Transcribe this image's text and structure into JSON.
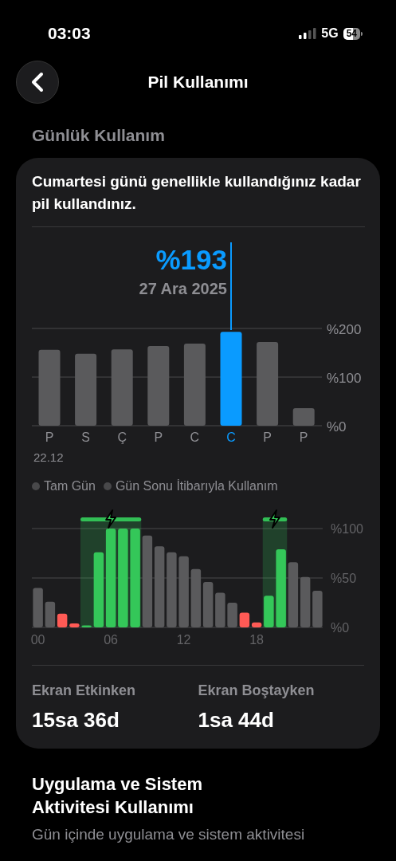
{
  "status_bar": {
    "time": "03:03",
    "network": "5G",
    "battery": "54"
  },
  "nav": {
    "title": "Pil Kullanımı"
  },
  "section_title": "Günlük Kullanım",
  "card": {
    "summary": "Cumartesi günü genellikle kullandığınız kadar pil kullandınız.",
    "weekly": {
      "selected_value": "%193",
      "selected_date": "27 Ara 2025",
      "first_date": "22.12",
      "chart_data": {
        "type": "bar",
        "categories": [
          "P",
          "S",
          "Ç",
          "P",
          "C",
          "C",
          "P",
          "P"
        ],
        "series": [
          {
            "color": "#5a5a5c",
            "values": [
              156,
              148,
              157,
              164,
              169,
              null,
              172,
              36
            ]
          },
          {
            "color": "#0a9bff",
            "values": [
              null,
              null,
              null,
              null,
              null,
              193,
              null,
              null
            ]
          }
        ],
        "ylim": [
          0,
          200
        ],
        "yticks": [
          {
            "value": 0,
            "label": "%0"
          },
          {
            "value": 100,
            "label": "%100"
          },
          {
            "value": 200,
            "label": "%200"
          }
        ]
      }
    },
    "legend": [
      {
        "label": "Tam Gün"
      },
      {
        "label": "Gün Sonu İtibarıyla Kullanım"
      }
    ],
    "hourly": {
      "chart_data": {
        "type": "bar",
        "x": [
          0,
          1,
          2,
          3,
          4,
          5,
          6,
          7,
          8,
          9,
          10,
          11,
          12,
          13,
          14,
          15,
          16,
          17,
          18,
          19,
          20,
          21,
          22,
          23
        ],
        "series": [
          {
            "color": "#5a5a5c",
            "values": [
              40,
              26,
              null,
              null,
              null,
              null,
              null,
              null,
              null,
              93,
              82,
              76,
              72,
              59,
              46,
              35,
              25,
              null,
              null,
              null,
              null,
              66,
              51,
              37
            ]
          },
          {
            "color": "#ff5a55",
            "values": [
              null,
              null,
              14,
              4,
              null,
              null,
              null,
              null,
              null,
              null,
              null,
              null,
              null,
              null,
              null,
              null,
              null,
              15,
              5,
              null,
              null,
              null,
              null,
              null
            ]
          },
          {
            "color": "#34c759",
            "values": [
              null,
              null,
              null,
              null,
              2,
              76,
              100,
              100,
              100,
              null,
              null,
              null,
              null,
              null,
              null,
              null,
              null,
              null,
              null,
              32,
              79,
              null,
              null,
              null
            ]
          }
        ],
        "xlim": [
          -0.5,
          23.5
        ],
        "ylim": [
          0,
          100
        ],
        "xticks": [
          {
            "value": 0,
            "label": "00"
          },
          {
            "value": 6,
            "label": "06"
          },
          {
            "value": 12,
            "label": "12"
          },
          {
            "value": 18,
            "label": "18"
          }
        ],
        "yticks": [
          {
            "value": 0,
            "label": "%0"
          },
          {
            "value": 50,
            "label": "%50"
          },
          {
            "value": 100,
            "label": "%100"
          }
        ],
        "bands": [
          {
            "axis": "x",
            "from": 3.5,
            "to": 8.5,
            "color": "#34c759"
          },
          {
            "axis": "x",
            "from": 18.5,
            "to": 20.5,
            "color": "#34c759"
          }
        ]
      }
    },
    "stats": [
      {
        "label": "Ekran Etkinken",
        "value": "15sa 36d"
      },
      {
        "label": "Ekran Boştayken",
        "value": "1sa 44d"
      }
    ]
  },
  "activity": {
    "title": "Uygulama ve Sistem Aktivitesi Kullanımı",
    "description": "Gün içinde uygulama ve sistem aktivitesi"
  }
}
